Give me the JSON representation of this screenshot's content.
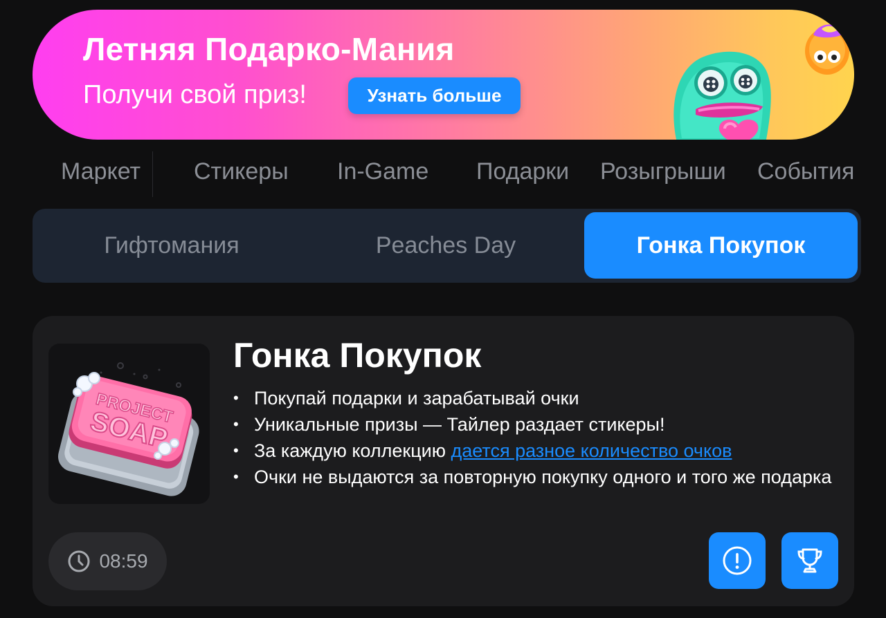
{
  "banner": {
    "title": "Летняя Подарко-Мания",
    "subtitle": "Получи свой приз!",
    "button_label": "Узнать больше",
    "gradient_start": "#ff3ef0",
    "gradient_end": "#ffd44e",
    "button_color": "#1a8cff"
  },
  "categories": [
    {
      "label": "Маркет"
    },
    {
      "label": "Стикеры"
    },
    {
      "label": "In-Game"
    },
    {
      "label": "Подарки"
    },
    {
      "label": "Розыгрыши"
    },
    {
      "label": "События"
    }
  ],
  "tabs": [
    {
      "label": "Гифтомания",
      "active": false
    },
    {
      "label": "Peaches Day",
      "active": false
    },
    {
      "label": "Гонка Покупок",
      "active": true
    }
  ],
  "event": {
    "title": "Гонка Покупок",
    "image_icon": "project-soap-icon",
    "bullets": {
      "b1": "Покупай подарки и зарабатывай очки",
      "b2": "Уникальные призы — Тайлер раздает стикеры!",
      "b3_prefix": "За каждую коллекцию ",
      "b3_link": "дается разное количество очков",
      "b4": "Очки не выдаются за повторную покупку одного и того же подарка"
    },
    "timer": "08:59",
    "info_icon": "info-icon",
    "trophy_icon": "trophy-icon"
  },
  "colors": {
    "accent": "#1a8cff",
    "background": "#0f0f10",
    "card": "#1c1c1e",
    "segmented_bg": "#1d2532",
    "muted_text": "#8c8f96"
  }
}
